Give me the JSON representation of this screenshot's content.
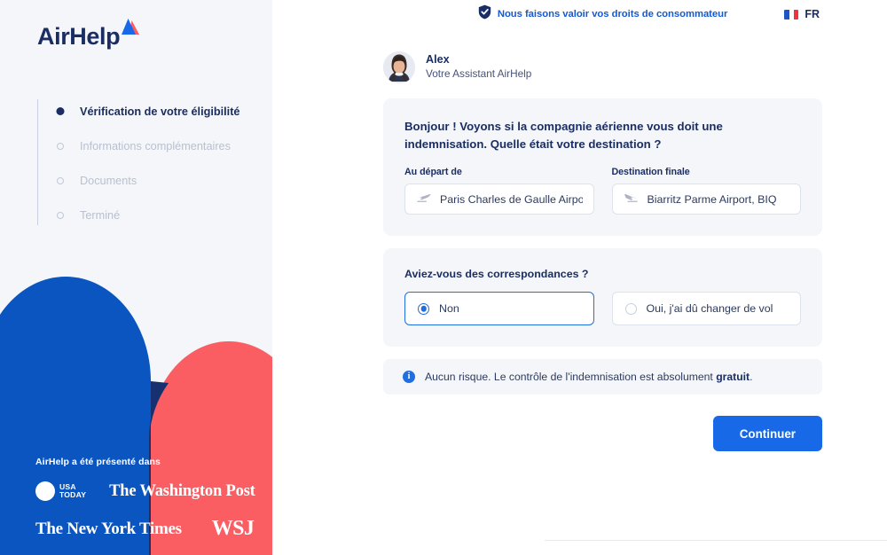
{
  "brand": {
    "name": "AirHelp",
    "logo_icon": "airhelp-triangle-logo",
    "colors": {
      "navy": "#1b2e63",
      "blue": "#0a55bf",
      "coral": "#fa5e62",
      "dark_overlap": "#17306f",
      "accent_button": "#1769e8",
      "sidebar_bg": "#f4f6fa"
    }
  },
  "sidebar": {
    "steps": [
      {
        "label": "Vérification de votre éligibilité",
        "state": "active"
      },
      {
        "label": "Informations complémentaires",
        "state": "inactive"
      },
      {
        "label": "Documents",
        "state": "inactive"
      },
      {
        "label": "Terminé",
        "state": "inactive"
      }
    ],
    "press": {
      "title": "AirHelp a été présenté dans",
      "logos": [
        {
          "name": "usa-today",
          "line1": "USA",
          "line2": "TODAY"
        },
        {
          "name": "the-washington-post",
          "text": "The Washington Post"
        },
        {
          "name": "the-new-york-times",
          "text": "The New York Times"
        },
        {
          "name": "wsj",
          "text": "WSJ"
        }
      ]
    }
  },
  "topbar": {
    "trust_icon": "shield-check-icon",
    "trust_text": "Nous faisons valoir vos droits de consommateur",
    "language": {
      "flag_icon": "flag-france-icon",
      "code": "FR"
    }
  },
  "agent": {
    "avatar_icon": "user-avatar-photo",
    "name": "Alex",
    "role": "Votre Assistant AirHelp"
  },
  "destination_card": {
    "question": "Bonjour ! Voyons si la compagnie aérienne vous doit une indemnisation. Quelle était votre destination ?",
    "departure": {
      "label": "Au départ de",
      "icon": "plane-departure-icon",
      "value": "Paris Charles de Gaulle Airport, C…",
      "placeholder": "Au départ de"
    },
    "arrival": {
      "label": "Destination finale",
      "icon": "plane-arrival-icon",
      "value": "Biarritz Parme Airport, BIQ",
      "placeholder": "Destination finale"
    }
  },
  "connections_card": {
    "question": "Aviez-vous des correspondances ?",
    "options": [
      {
        "label": "Non",
        "selected": true
      },
      {
        "label": "Oui, j'ai dû changer de vol",
        "selected": false
      }
    ]
  },
  "banner": {
    "icon": "info-icon",
    "text_before": "Aucun risque. Le contrôle de l'indemnisation est absolument ",
    "text_bold": "gratuit",
    "text_after": "."
  },
  "actions": {
    "continue_label": "Continuer"
  }
}
